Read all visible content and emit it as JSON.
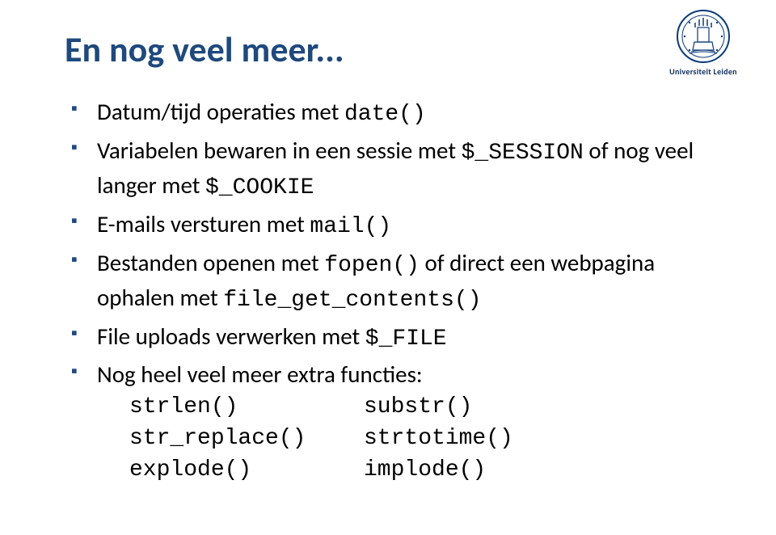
{
  "logo": {
    "university_name": "Universiteit Leiden"
  },
  "slide": {
    "title": "En nog veel meer...",
    "bullets": {
      "b1_a": "Datum/tijd operaties met ",
      "b1_code": "date()",
      "b2_a": "Variabelen bewaren in een sessie met ",
      "b2_code1": "$_SESSION",
      "b2_b": " of nog veel langer met ",
      "b2_code2": "$_COOKIE",
      "b3_a": "E-mails versturen met ",
      "b3_code": "mail()",
      "b4_a": "Bestanden openen met ",
      "b4_code1": "fopen()",
      "b4_b": " of direct een webpagina ophalen met ",
      "b4_code2": "file_get_contents()",
      "b5_a": "File uploads verwerken met ",
      "b5_code": "$_FILE",
      "b6_a": "Nog heel veel meer extra functies:"
    },
    "functions": {
      "r1c1": "strlen()",
      "r1c2": "substr()",
      "r2c1": "str_replace()",
      "r2c2": "strtotime()",
      "r3c1": "explode()",
      "r3c2": "implode()"
    }
  }
}
